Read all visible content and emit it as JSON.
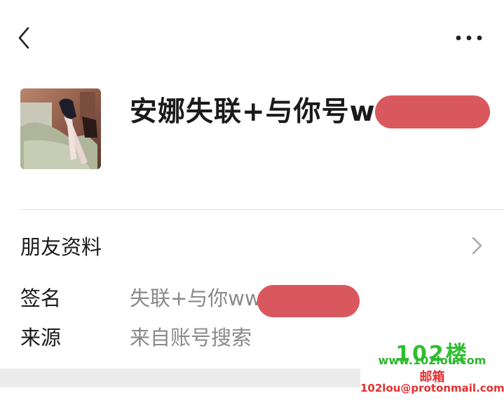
{
  "header": {
    "back_icon": "chevron-left-icon",
    "more_icon": "more-dots-icon"
  },
  "profile": {
    "name": "安娜失联+与你号w"
  },
  "friend_info": {
    "title": "朋友资料",
    "chevron_icon": "chevron-right-icon"
  },
  "details": [
    {
      "label": "签名",
      "value": "失联+与你ww"
    },
    {
      "label": "来源",
      "value": "来自账号搜索"
    }
  ],
  "watermark": {
    "brand": "102楼",
    "site": "www.102lou.com",
    "mail_label": "邮箱",
    "email": "102lou@protonmail.com"
  },
  "colors": {
    "redaction": "#d9585d",
    "watermark_green": "#2fbf2f",
    "watermark_red": "#e53030"
  }
}
